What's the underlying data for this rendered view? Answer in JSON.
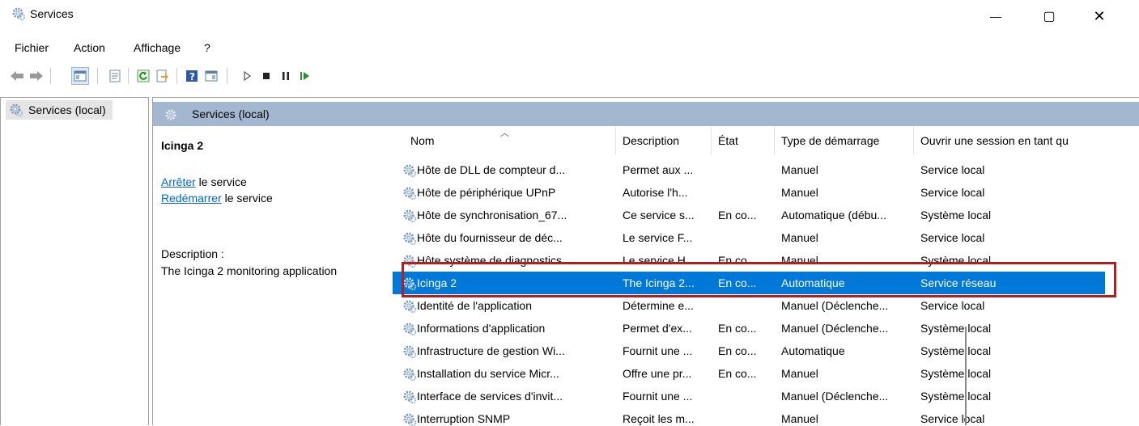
{
  "window": {
    "title": "Services",
    "minimize": "—",
    "maximize": "▢",
    "close": "✕"
  },
  "menu": [
    "Fichier",
    "Action",
    "Affichage",
    "?"
  ],
  "tree": {
    "item": "Services (local)"
  },
  "panel": {
    "header": "Services (local)",
    "service_name": "Icinga 2",
    "stop_link": "Arrêter",
    "stop_suffix": " le service",
    "restart_link": "Redémarrer",
    "restart_suffix": " le service",
    "description_label": "Description :",
    "description_text": "The Icinga 2 monitoring application"
  },
  "columns": [
    "Nom",
    "Description",
    "État",
    "Type de démarrage",
    "Ouvrir une session en tant qu"
  ],
  "rows": [
    {
      "name": "Hôte de DLL de compteur d...",
      "desc": "Permet aux ...",
      "state": "",
      "startup": "Manuel",
      "logon": "Service local"
    },
    {
      "name": "Hôte de périphérique UPnP",
      "desc": "Autorise l'h...",
      "state": "",
      "startup": "Manuel",
      "logon": "Service local"
    },
    {
      "name": "Hôte de synchronisation_67...",
      "desc": "Ce service s...",
      "state": "En co...",
      "startup": "Automatique (débu...",
      "logon": "Système local"
    },
    {
      "name": "Hôte du fournisseur de déc...",
      "desc": "Le service F...",
      "state": "",
      "startup": "Manuel",
      "logon": "Service local"
    },
    {
      "name": "Hôte système de diagnostics",
      "desc": "Le service H...",
      "state": "En co...",
      "startup": "Manuel",
      "logon": "Système local"
    },
    {
      "name": "Icinga 2",
      "desc": "The Icinga 2...",
      "state": "En co...",
      "startup": "Automatique",
      "logon": "Service réseau",
      "selected": true
    },
    {
      "name": "Identité de l'application",
      "desc": "Détermine e...",
      "state": "",
      "startup": "Manuel (Déclenche...",
      "logon": "Service local"
    },
    {
      "name": "Informations d'application",
      "desc": "Permet d'ex...",
      "state": "En co...",
      "startup": "Manuel (Déclenche...",
      "logon": "Système local"
    },
    {
      "name": "Infrastructure de gestion Wi...",
      "desc": "Fournit une ...",
      "state": "En co...",
      "startup": "Automatique",
      "logon": "Système local"
    },
    {
      "name": "Installation du service Micr...",
      "desc": "Offre une pr...",
      "state": "En co...",
      "startup": "Manuel",
      "logon": "Système local"
    },
    {
      "name": "Interface de services d'invit...",
      "desc": "Fournit une ...",
      "state": "",
      "startup": "Manuel (Déclenche...",
      "logon": "Système local"
    },
    {
      "name": "Interruption SNMP",
      "desc": "Reçoit les m...",
      "state": "",
      "startup": "Manuel",
      "logon": "Service local"
    }
  ],
  "colors": {
    "selection": "#0078d7",
    "header_band": "#a3b8d0",
    "link": "#0066cc",
    "highlight_box": "#b02020"
  }
}
